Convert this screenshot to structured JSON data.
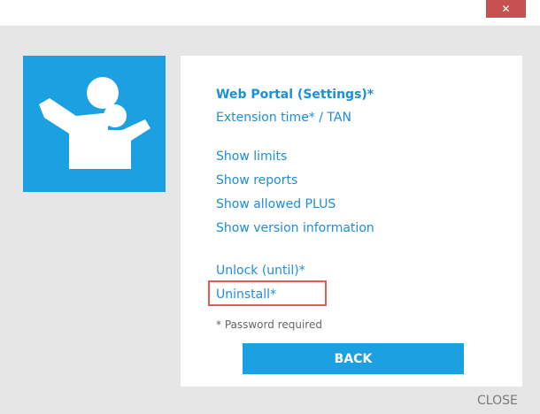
{
  "window": {
    "close_glyph": "✕"
  },
  "logo": {
    "icon": "family-icon",
    "background": "#1ba1e2"
  },
  "menu": {
    "web_portal": "Web Portal (Settings)*",
    "extension_time": "Extension time* / TAN",
    "show_limits": "Show limits",
    "show_reports": "Show reports",
    "show_allowed_plus": "Show allowed PLUS",
    "show_version": "Show version information",
    "unlock": "Unlock (until)*",
    "uninstall": "Uninstall*"
  },
  "note": "* Password required",
  "back_label": "BACK",
  "close_label": "CLOSE",
  "colors": {
    "accent": "#1ba1e2",
    "link": "#1c8fd6",
    "highlight": "#e25b5b",
    "window_close": "#c75050"
  }
}
